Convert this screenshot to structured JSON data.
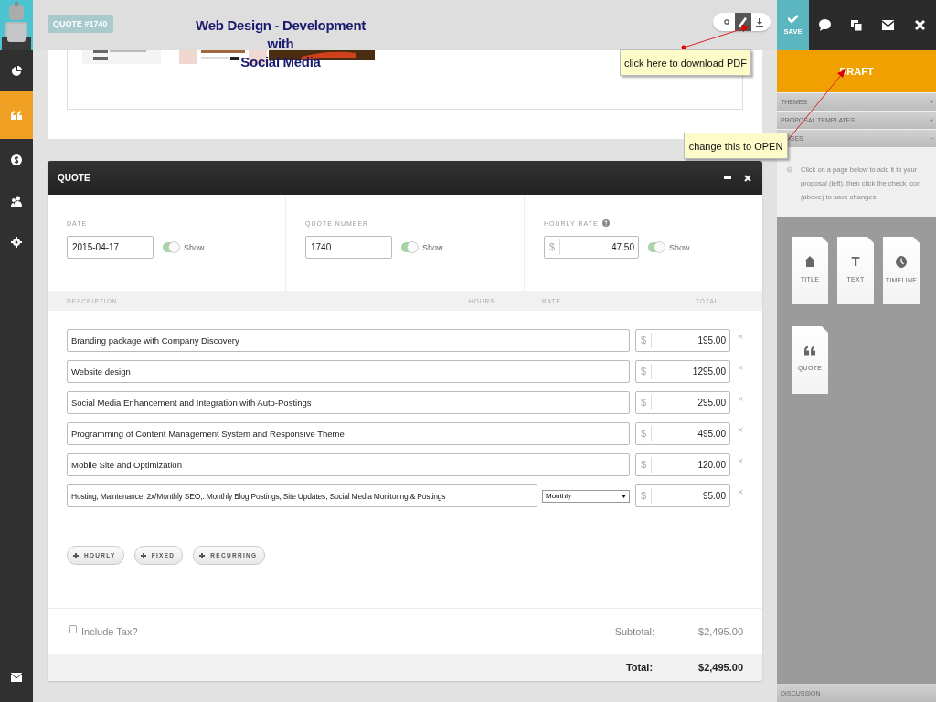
{
  "sidebar": {
    "items": [
      {
        "kind": "chart",
        "selected": false
      },
      {
        "kind": "quote",
        "selected": true
      },
      {
        "kind": "money",
        "selected": false
      },
      {
        "kind": "users",
        "selected": false
      },
      {
        "kind": "settings",
        "selected": false
      }
    ]
  },
  "header": {
    "badge": "QUOTE #1740",
    "title_lines": [
      "Web Design - Development",
      "with",
      "Social Media"
    ],
    "tools": [
      {
        "kind": "circle",
        "selected": false
      },
      {
        "kind": "pencil",
        "selected": true
      },
      {
        "kind": "download",
        "selected": false
      }
    ]
  },
  "callouts": [
    {
      "text": "click here to download PDF"
    },
    {
      "text": "change this to OPEN"
    }
  ],
  "quote": {
    "title": "QUOTE",
    "fields": [
      {
        "label": "DATE",
        "value": "2015-04-17",
        "show": true,
        "show_label": "Show",
        "help": false
      },
      {
        "label": "QUOTE NUMBER",
        "value": "1740",
        "show": true,
        "show_label": "Show",
        "help": false
      },
      {
        "label": "HOURLY RATE",
        "prefix": "$",
        "value": "47.50",
        "show": true,
        "show_label": "Show",
        "help": true
      }
    ],
    "columns": [
      "DESCRIPTION",
      "HOURS",
      "RATE",
      "TOTAL"
    ],
    "rows": [
      {
        "description": "Branding package with Company Discovery",
        "currency": "$",
        "total": "195.00",
        "remove": "×"
      },
      {
        "description": "Website design",
        "currency": "$",
        "total": "1295.00",
        "remove": "×"
      },
      {
        "description": "Social Media Enhancement and Integration with Auto-Postings",
        "currency": "$",
        "total": "295.00",
        "remove": "×"
      },
      {
        "description": "Programming of Content Management System and Responsive Theme",
        "currency": "$",
        "total": "495.00",
        "remove": "×"
      },
      {
        "description": "Mobile Site and Optimization",
        "currency": "$",
        "total": "120.00",
        "remove": "×"
      },
      {
        "description": "Hosting, Maintenance, 2x/Monthly SEO,. Monthly Blog Postings, Site Updates, Social Media Monitoring & Postings",
        "frequency": "Monthly",
        "currency": "$",
        "total": "95.00",
        "remove": "×"
      }
    ],
    "add_buttons": [
      "HOURLY",
      "FIXED",
      "RECURRING"
    ],
    "tax": {
      "label": "Include Tax?",
      "checked": false
    },
    "subtotal": {
      "label": "Subtotal:",
      "value": "$2,495.00"
    },
    "total": {
      "label": "Total:",
      "value": "$2,495.00"
    }
  },
  "panel": {
    "actions": [
      {
        "kind": "save",
        "label": "SAVE"
      },
      {
        "kind": "comment"
      },
      {
        "kind": "copy"
      },
      {
        "kind": "mail"
      },
      {
        "kind": "close"
      }
    ],
    "status": "DRAFT",
    "sections": [
      {
        "label": "THEMES",
        "sign": "+"
      },
      {
        "label": "PROPOSAL TEMPLATES",
        "sign": "+"
      },
      {
        "label": "GES",
        "sign": "−"
      }
    ],
    "help": "Click on a page below to add it to your proposal (left), then click the check icon (above) to save changes.",
    "pages": [
      {
        "kind": "home",
        "label": "TITLE"
      },
      {
        "kind": "glyph",
        "glyph": "T",
        "label": "TEXT"
      },
      {
        "kind": "clock",
        "label": "TIMELINE"
      },
      {
        "kind": "quote",
        "label": "QUOTE"
      }
    ],
    "discussion": "DISCUSSION"
  }
}
